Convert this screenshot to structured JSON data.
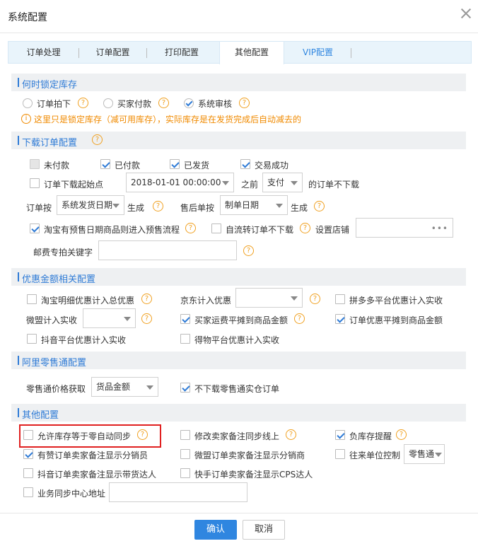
{
  "dialog": {
    "title": "系统配置"
  },
  "tabs": [
    {
      "label": "订单处理"
    },
    {
      "label": "订单配置"
    },
    {
      "label": "打印配置"
    },
    {
      "label": "其他配置"
    },
    {
      "label": "VIP配置"
    }
  ],
  "lock_stock": {
    "title": "何时锁定库存",
    "options": [
      "订单拍下",
      "买家付款",
      "系统审核"
    ],
    "selected": "系统审核",
    "warning": "这里只是锁定库存（减可用库存），实际库存是在发货完成后自动减去的"
  },
  "download": {
    "title": "下载订单配置",
    "status_unpaid": "未付款",
    "status_paid": "已付款",
    "status_shipped": "已发货",
    "status_success": "交易成功",
    "start_point_label": "订单下载起始点",
    "start_date": "2018-01-01 00:00:00",
    "before_label": "之前",
    "before_status": "支付",
    "not_download_label": "的订单不下载",
    "order_by_label": "订单按",
    "order_by_value": "系统发货日期",
    "generate_label_1": "生成",
    "aftersale_label": "售后单按",
    "aftersale_value": "制单日期",
    "generate_label_2": "生成",
    "presale_label": "淘宝有预售日期商品则进入预售流程",
    "self_flow_label": "自流转订单不下载",
    "set_shop_label": "设置店铺",
    "postage_keyword_label": "邮费专拍关键字"
  },
  "discount": {
    "title": "优惠金额相关配置",
    "taobao_detail": "淘宝明细优惠计入总优惠",
    "jd_label": "京东计入优惠",
    "pdd_label": "拼多多平台优惠计入实收",
    "weimeng_label": "微盟计入实收",
    "buyer_freight": "买家运费平摊到商品金额",
    "order_discount": "订单优惠平摊到商品金额",
    "douyin_label": "抖音平台优惠计入实收",
    "dewu_label": "得物平台优惠计入实收"
  },
  "ali_retail": {
    "title": "阿里零售通配置",
    "price_label": "零售通价格获取",
    "price_value": "货品金额",
    "no_download_label": "不下载零售通实仓订单"
  },
  "other": {
    "title": "其他配置",
    "allow_zero_sync": "允许库存等于零自动同步",
    "modify_memo_sync": "修改卖家备注同步线上",
    "negative_stock_alert": "负库存提醒",
    "youzan_memo": "有赞订单卖家备注显示分销员",
    "weimeng_memo": "微盟订单卖家备注显示分销商",
    "partner_control": "往来单位控制",
    "partner_value": "零售通",
    "douyin_memo": "抖音订单卖家备注显示带货达人",
    "kuaishou_memo": "快手订单卖家备注显示CPS达人",
    "sync_center_label": "业务同步中心地址"
  },
  "footer": {
    "ok_label": "确认",
    "cancel_label": "取消"
  },
  "colors": {
    "accent": "#2f7bd6",
    "warning": "#f08a00",
    "highlight": "#e02020"
  }
}
